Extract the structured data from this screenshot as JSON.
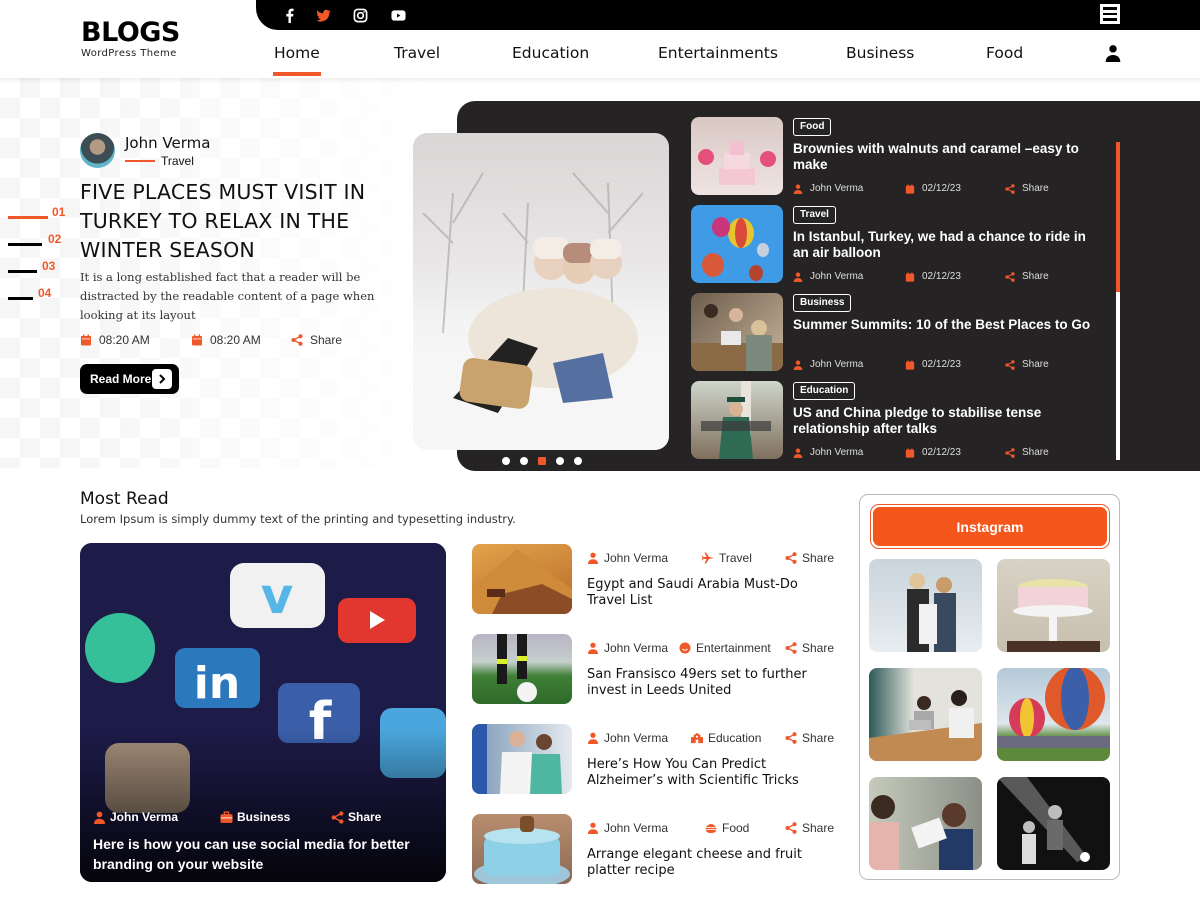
{
  "header": {
    "logo_title": "BLOGS",
    "logo_subtitle": "WordPress Theme",
    "social_icons": [
      "facebook-icon",
      "twitter-icon",
      "instagram-icon",
      "youtube-icon"
    ],
    "nav": [
      {
        "label": "Home",
        "active": true
      },
      {
        "label": "Travel",
        "active": false
      },
      {
        "label": "Education",
        "active": false
      },
      {
        "label": "Entertainments",
        "active": false
      },
      {
        "label": "Business",
        "active": false
      },
      {
        "label": "Food",
        "active": false
      }
    ],
    "accent_color": "#f0582a"
  },
  "hero": {
    "pager": [
      "01",
      "02",
      "03",
      "04"
    ],
    "active_page": "01",
    "author": "John Verma",
    "category": "Travel",
    "title": "FIVE PLACES MUST VISIT IN TURKEY TO RELAX IN THE WINTER SEASON",
    "description": "It is a long established fact that a reader will be distracted by the readable content of a page when looking at its layout",
    "meta": [
      {
        "icon": "calendar-icon",
        "text": "08:20 AM"
      },
      {
        "icon": "calendar-icon",
        "text": "08:20 AM"
      },
      {
        "icon": "share-icon",
        "text": "Share"
      }
    ],
    "read_more": "Read More",
    "slider_dots": 5,
    "active_dot": 3
  },
  "side_posts": [
    {
      "tag": "Food",
      "title": "Brownies with walnuts and caramel –easy to make",
      "author": "John Verma",
      "date": "02/12/23",
      "share": "Share"
    },
    {
      "tag": "Travel",
      "title": "In Istanbul, Turkey, we had a chance to ride in an air balloon",
      "author": "John Verma",
      "date": "02/12/23",
      "share": "Share"
    },
    {
      "tag": "Business",
      "title": "Summer Summits: 10 of the Best Places to Go",
      "author": "John Verma",
      "date": "02/12/23",
      "share": "Share"
    },
    {
      "tag": "Education",
      "title": "US and China pledge to stabilise tense relationship after talks",
      "author": "John Verma",
      "date": "02/12/23",
      "share": "Share"
    }
  ],
  "most_read": {
    "title": "Most Read",
    "subtitle": "Lorem Ipsum is simply dummy text of the printing and typesetting industry.",
    "feature": {
      "author": "John Verma",
      "category": "Business",
      "share": "Share",
      "title": "Here is how you can use social media for better branding on your website"
    },
    "list": [
      {
        "author": "John Verma",
        "category": "Travel",
        "category_icon": "plane-icon",
        "share": "Share",
        "title": "Egypt and Saudi Arabia Must-Do Travel List"
      },
      {
        "author": "John Verma",
        "category": "Entertainment",
        "category_icon": "smiley-icon",
        "share": "Share",
        "title": "San Fransisco 49ers set to further invest in Leeds United"
      },
      {
        "author": "John Verma",
        "category": "Education",
        "category_icon": "school-icon",
        "share": "Share",
        "title": "Here’s How You Can Predict Alzheimer’s with Scientific Tricks"
      },
      {
        "author": "John Verma",
        "category": "Food",
        "category_icon": "burger-icon",
        "share": "Share",
        "title": "Arrange elegant cheese and fruit platter recipe"
      }
    ]
  },
  "instagram": {
    "button": "Instagram",
    "images": [
      "two-women-photo",
      "cake-photo",
      "meeting-photo",
      "balloons-photo",
      "office-photo",
      "concert-photo"
    ]
  }
}
